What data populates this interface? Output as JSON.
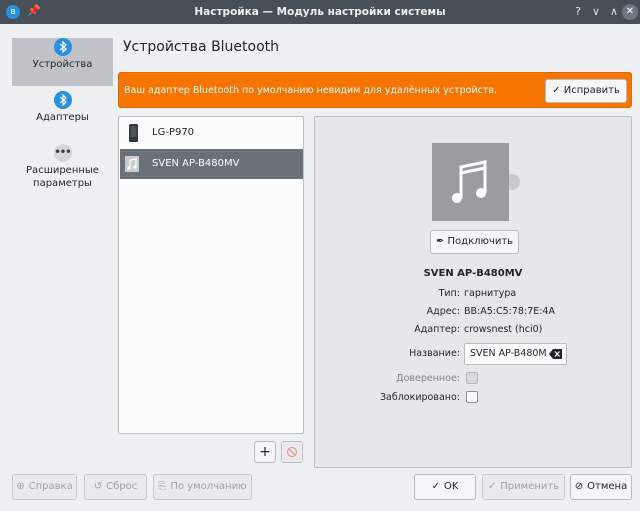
{
  "window": {
    "title": "Настройка — Модуль настройки системы",
    "help_glyph": "?",
    "minimize_glyph": "∨",
    "maximize_glyph": "∧",
    "close_glyph": "✕"
  },
  "sidebar": {
    "items": [
      {
        "label": "Устройства",
        "icon": "bluetooth-icon",
        "active": true
      },
      {
        "label": "Адаптеры",
        "icon": "bluetooth-icon",
        "active": false
      },
      {
        "label": "Расширенные параметры",
        "icon": "more-icon",
        "active": false
      }
    ]
  },
  "page": {
    "title": "Устройства Bluetooth"
  },
  "banner": {
    "message": "Ваш адаптер Bluetooth по умолчанию невидим для удалённых устройств.",
    "fix_label": "Исправить",
    "color": "#f67400"
  },
  "devices": [
    {
      "name": "LG-P970",
      "icon": "phone-icon",
      "selected": false
    },
    {
      "name": "SVEN AP-B480MV",
      "icon": "audio-device-icon",
      "selected": true
    }
  ],
  "details": {
    "connect_label": "Подключить",
    "device_name": "SVEN AP-B480MV",
    "type_label": "Тип:",
    "type_value": "гарнитура",
    "address_label": "Адрес:",
    "address_value": "BB:A5:C5:78:7E:4A",
    "adapter_label": "Адаптер:",
    "adapter_value": "crowsnest (hci0)",
    "name_label": "Название:",
    "name_value": "SVEN AP-B480M",
    "trusted_label": "Доверенное:",
    "trusted_checked": false,
    "blocked_label": "Заблокировано:",
    "blocked_checked": false
  },
  "footer": {
    "help": "Справка",
    "reset": "Сброс",
    "defaults": "По умолчанию",
    "ok": "OK",
    "apply": "Применить",
    "cancel": "Отмена"
  },
  "colors": {
    "accent": "#2b8fe0",
    "selection": "#697078",
    "titlebar": "#475057"
  }
}
